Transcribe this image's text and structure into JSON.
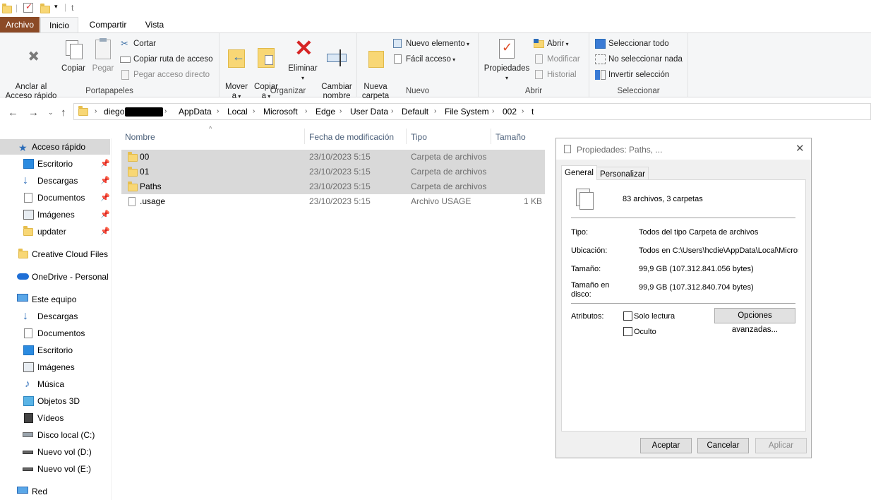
{
  "titlebar": {
    "title": "t"
  },
  "ribbon_tabs": [
    "Archivo",
    "Inicio",
    "Compartir",
    "Vista"
  ],
  "ribbon": {
    "portapapeles": {
      "label": "Portapapeles",
      "pin": "Anclar al\nAcceso rápido",
      "copy": "Copiar",
      "paste": "Pegar",
      "cut": "Cortar",
      "copy_path": "Copiar ruta de acceso",
      "paste_shortcut": "Pegar acceso directo"
    },
    "organizar": {
      "label": "Organizar",
      "move": "Mover\na",
      "copy_to": "Copiar\na",
      "delete": "Eliminar",
      "rename": "Cambiar\nnombre"
    },
    "nuevo": {
      "label": "Nuevo",
      "new_folder": "Nueva\ncarpeta",
      "new_item": "Nuevo elemento",
      "easy_access": "Fácil acceso"
    },
    "abrir": {
      "label": "Abrir",
      "properties": "Propiedades",
      "open": "Abrir",
      "edit": "Modificar",
      "history": "Historial"
    },
    "seleccionar": {
      "label": "Seleccionar",
      "select_all": "Seleccionar todo",
      "select_none": "No seleccionar nada",
      "invert": "Invertir selección"
    }
  },
  "breadcrumb": [
    "diego",
    "AppData",
    "Local",
    "Microsoft",
    "Edge",
    "User Data",
    "Default",
    "File System",
    "002",
    "t"
  ],
  "sidebar": {
    "quick_access": "Acceso rápido",
    "quick_items": [
      "Escritorio",
      "Descargas",
      "Documentos",
      "Imágenes",
      "updater"
    ],
    "creative_cloud": "Creative Cloud Files",
    "onedrive": "OneDrive - Personal",
    "this_pc": "Este equipo",
    "pc_items": [
      "Descargas",
      "Documentos",
      "Escritorio",
      "Imágenes",
      "Música",
      "Objetos 3D",
      "Vídeos",
      "Disco local (C:)",
      "Nuevo vol (D:)",
      "Nuevo vol (E:)"
    ],
    "network": "Red"
  },
  "columns": {
    "name": "Nombre",
    "date": "Fecha de modificación",
    "type": "Tipo",
    "size": "Tamaño"
  },
  "files": [
    {
      "name": "00",
      "date": "23/10/2023 5:15",
      "type": "Carpeta de archivos",
      "size": "",
      "selected": true
    },
    {
      "name": "01",
      "date": "23/10/2023 5:15",
      "type": "Carpeta de archivos",
      "size": "",
      "selected": true
    },
    {
      "name": "Paths",
      "date": "23/10/2023 5:15",
      "type": "Carpeta de archivos",
      "size": "",
      "selected": true
    },
    {
      "name": ".usage",
      "date": "23/10/2023 5:15",
      "type": "Archivo USAGE",
      "size": "1 KB",
      "selected": false
    }
  ],
  "dialog": {
    "title": "Propiedades: Paths, ...",
    "tabs": [
      "General",
      "Personalizar"
    ],
    "summary": "83 archivos, 3 carpetas",
    "type_label": "Tipo:",
    "type_value": "Todos del tipo Carpeta de archivos",
    "location_label": "Ubicación:",
    "location_value": "Todos en C:\\Users\\hcdie\\AppData\\Local\\Micros",
    "size_label": "Tamaño:",
    "size_value": "99,9 GB (107.312.841.056 bytes)",
    "disk_label": "Tamaño en\ndisco:",
    "disk_value": "99,9 GB (107.312.840.704 bytes)",
    "attributes_label": "Atributos:",
    "readonly": "Solo lectura",
    "hidden": "Oculto",
    "advanced": "Opciones avanzadas...",
    "ok": "Aceptar",
    "cancel": "Cancelar",
    "apply": "Aplicar"
  }
}
